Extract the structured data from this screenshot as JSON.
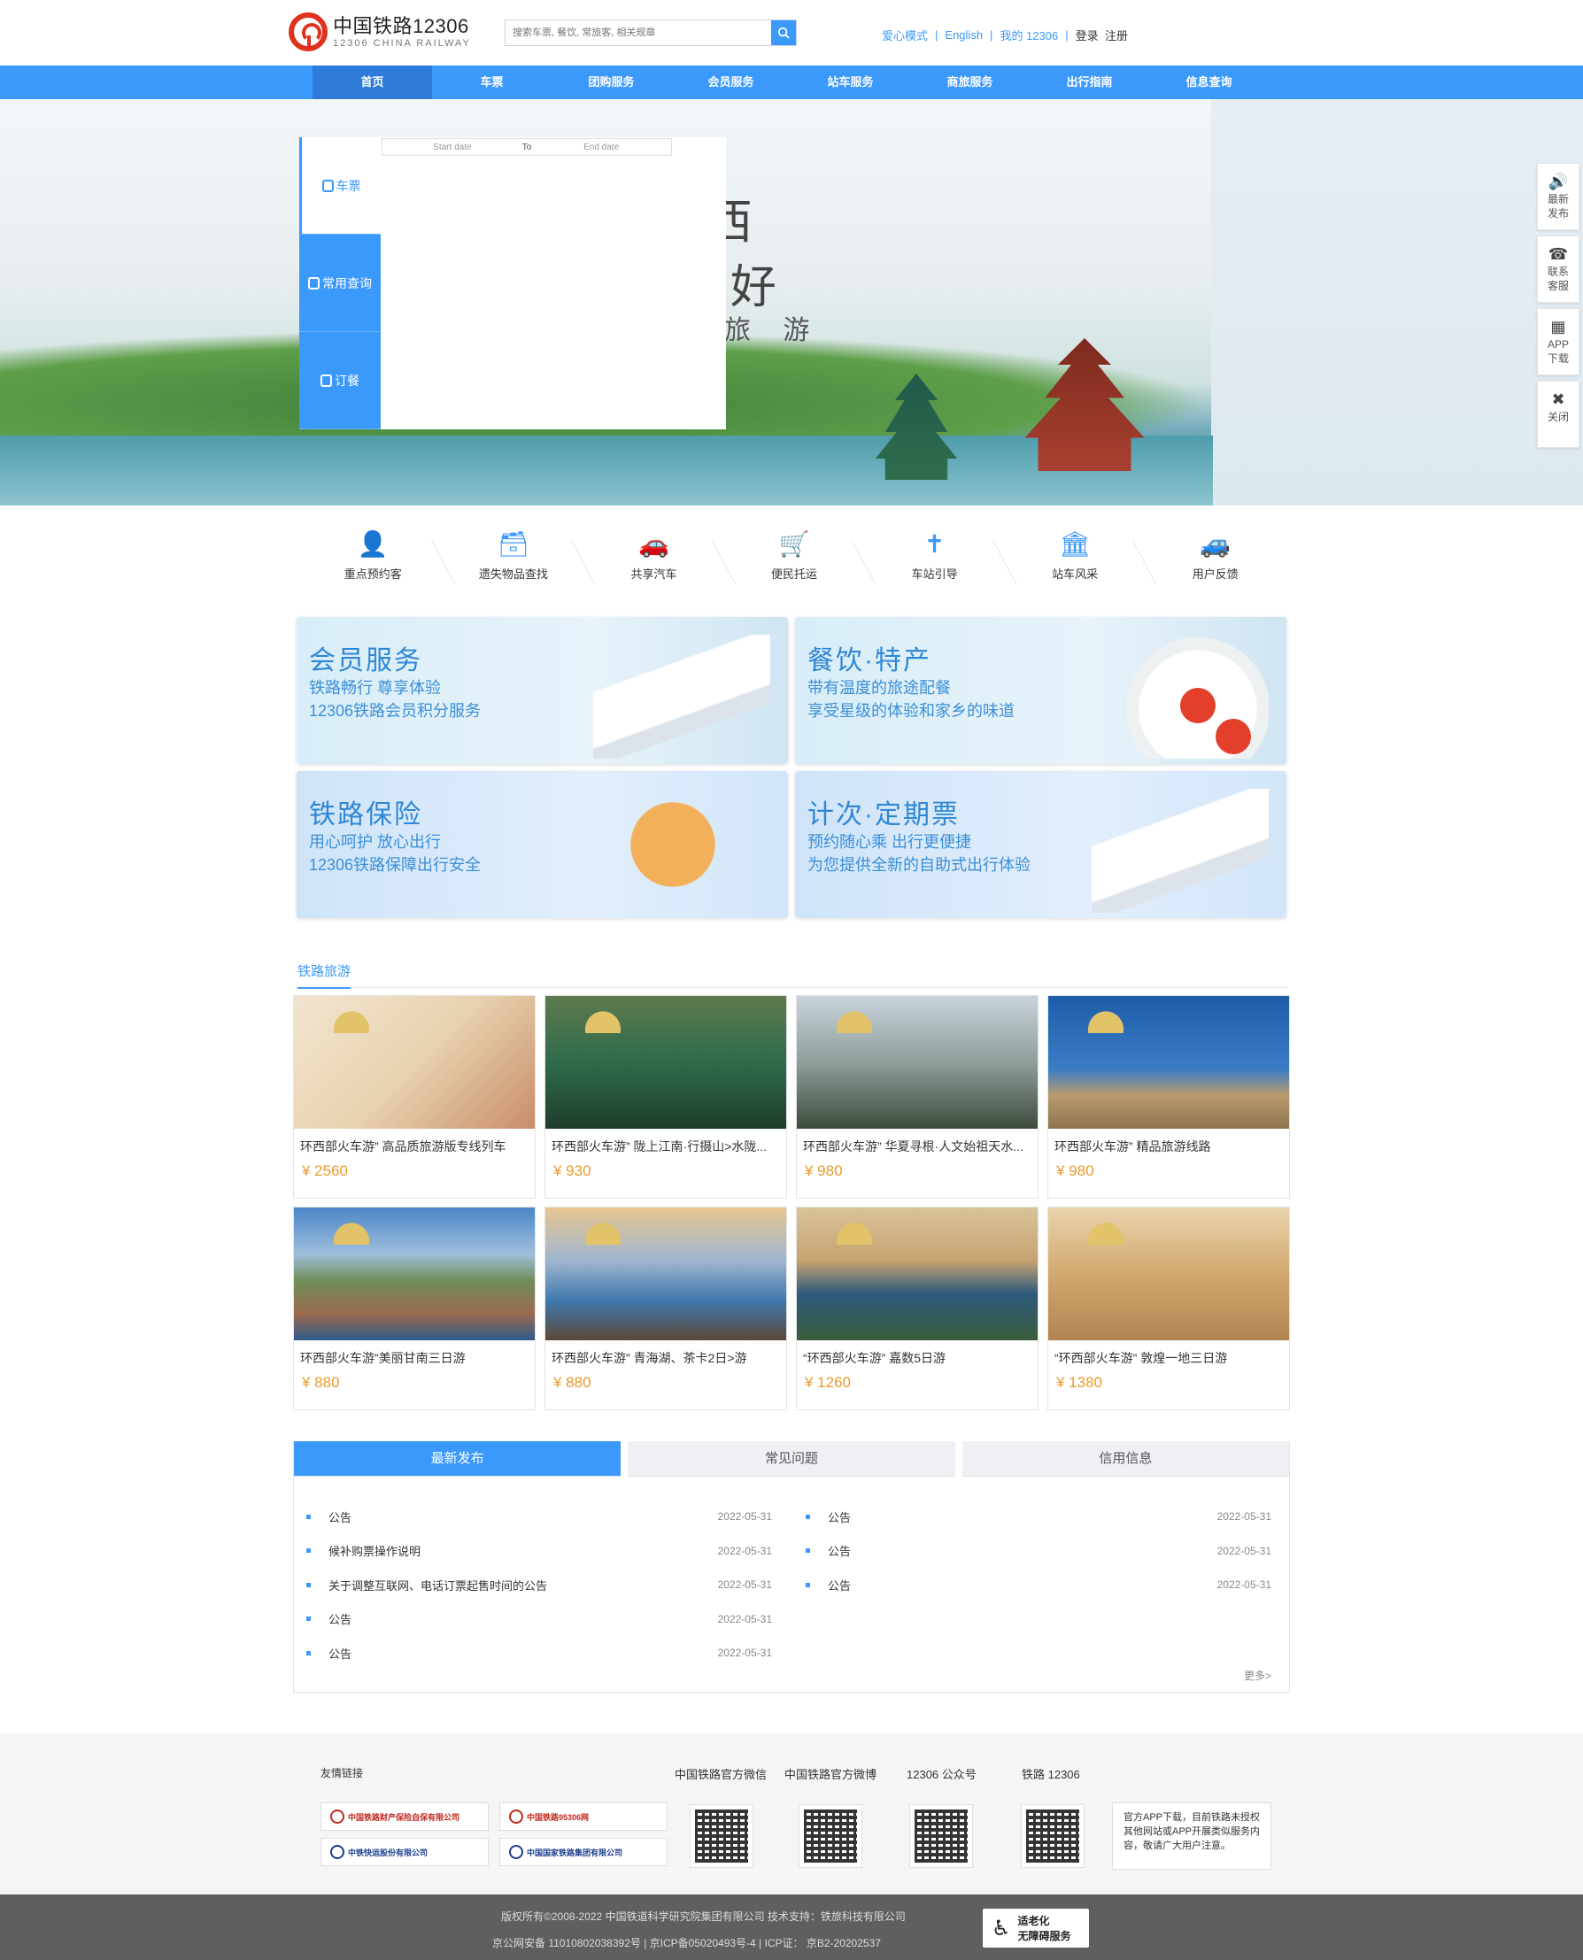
{
  "header": {
    "logo_cn": "中国铁路12306",
    "logo_en": "12306 CHINA RAILWAY",
    "search_placeholder": "搜索车票, 餐饮, 常旅客, 相关规章",
    "links": [
      "爱心模式",
      "English",
      "我的 12306"
    ],
    "login": "登录",
    "register": "注册"
  },
  "nav": [
    "首页",
    "车票",
    "团购服务",
    "会员服务",
    "站车服务",
    "商旅服务",
    "出行指南",
    "信息查询"
  ],
  "hero": {
    "text1": "西",
    "text2": "/ 好",
    "text3": "旅 游"
  },
  "booking": {
    "tabs": [
      "车票",
      "常用查询",
      "订餐"
    ],
    "start_date": "Start date",
    "to": "To",
    "end_date": "End date"
  },
  "side_tools": [
    {
      "icon": "speaker-icon",
      "label": "最新发布"
    },
    {
      "icon": "phone-icon",
      "label": "联系客服"
    },
    {
      "icon": "qr-icon",
      "label": "APP下载"
    },
    {
      "icon": "close-icon",
      "label": "关闭"
    }
  ],
  "services": [
    "重点预约客",
    "遗失物品查找",
    "共享汽车",
    "便民托运",
    "车站引导",
    "站车风采",
    "用户反馈"
  ],
  "promos": [
    {
      "title": "会员服务",
      "line1": "铁路畅行 尊享体验",
      "line2": "12306铁路会员积分服务"
    },
    {
      "title": "餐饮·特产",
      "line1": "带有温度的旅途配餐",
      "line2": "享受星级的体验和家乡的味道"
    },
    {
      "title": "铁路保险",
      "line1": "用心呵护 放心出行",
      "line2": "12306铁路保障出行安全"
    },
    {
      "title": "计次·定期票",
      "line1": "预约随心乘  出行更便捷",
      "line2": "为您提供全新的自助式出行体验"
    }
  ],
  "travel": {
    "title": "铁路旅游",
    "items": [
      {
        "name": "环西部火车游” 高品质旅游版专线列车",
        "price": "¥ 2560"
      },
      {
        "name": "环西部火车游” 陇上江南·行摄山>水陇...",
        "price": "¥ 930"
      },
      {
        "name": "环西部火车游” 华夏寻根·人文始祖天水...",
        "price": "¥ 980"
      },
      {
        "name": "环西部火车游” 精品旅游线路",
        "price": "¥ 980"
      },
      {
        "name": "环西部火车游”美丽甘南三日游",
        "price": "¥ 880"
      },
      {
        "name": "环西部火车游” 青海湖、茶卡2日>游",
        "price": "¥ 880"
      },
      {
        "name": "“环西部火车游” 嘉数5日游",
        "price": "¥ 1260"
      },
      {
        "name": "“环西部火车游” 敦煌一地三日游",
        "price": "¥ 1380"
      }
    ]
  },
  "notice": {
    "tabs": [
      "最新发布",
      "常见问题",
      "信用信息"
    ],
    "left": [
      {
        "title": "公告",
        "date": "2022-05-31"
      },
      {
        "title": "候补购票操作说明",
        "date": "2022-05-31"
      },
      {
        "title": "关于调整互联网、电话订票起售时间的公告",
        "date": "2022-05-31"
      },
      {
        "title": "公告",
        "date": "2022-05-31"
      },
      {
        "title": "公告",
        "date": "2022-05-31"
      }
    ],
    "right": [
      {
        "title": "公告",
        "date": "2022-05-31"
      },
      {
        "title": "公告",
        "date": "2022-05-31"
      },
      {
        "title": "公告",
        "date": "2022-05-31"
      }
    ],
    "more": "更多>"
  },
  "footer": {
    "friend_links_title": "友情链接",
    "friend_links": [
      "中国铁路财产保险自保有限公司",
      "中国铁路95306网",
      "中铁快运股份有限公司",
      "中国国家铁路集团有限公司"
    ],
    "qr_titles": [
      "中国铁路官方微信",
      "中国铁路官方微博",
      "12306 公众号",
      "铁路 12306"
    ],
    "note": "官方APP下载，目前铁路未授权其他网站或APP开展类似服务内容，敬请广大用户注意。",
    "copyright": "版权所有©2008-2022   中国铁道科学研究院集团有限公司   技术支持：铁旅科技有限公司",
    "icp": "京公网安备  11010802038392号  |  京ICP备05020493号-4  |  ICP证：  京B2-20202537",
    "badge_line1": "适老化",
    "badge_line2": "无障碍服务"
  },
  "colors": {
    "accent": "#3b99fc",
    "nav_active": "#2d7ad9",
    "price": "#e89a2a",
    "logo_red": "#e0301e"
  }
}
